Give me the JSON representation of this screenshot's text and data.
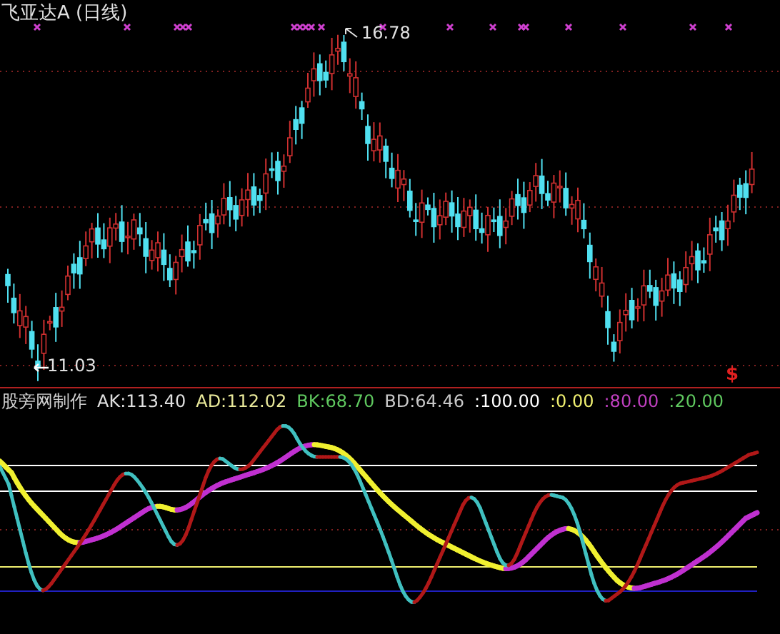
{
  "chart_title": "飞亚达A (日线)",
  "price_labels": [
    {
      "kind": "high",
      "text": "16.78"
    },
    {
      "kind": "low",
      "text": "11.03"
    }
  ],
  "signal_mark": "$",
  "legend": [
    {
      "text": "股旁网制作",
      "color": "#d0d0d0"
    },
    {
      "text": "AK:113.40",
      "color": "#e0e0e0"
    },
    {
      "text": "AD:112.02",
      "color": "#e8e89a"
    },
    {
      "text": "BK:68.70",
      "color": "#5fc85f"
    },
    {
      "text": "BD:64.46",
      "color": "#c8c8c8"
    },
    {
      "text": ":100.00",
      "color": "#ffffff"
    },
    {
      "text": ":0.00",
      "color": "#f0f070"
    },
    {
      "text": ":80.00",
      "color": "#c040c0"
    },
    {
      "text": ":20.00",
      "color": "#5fc85f"
    }
  ]
}
